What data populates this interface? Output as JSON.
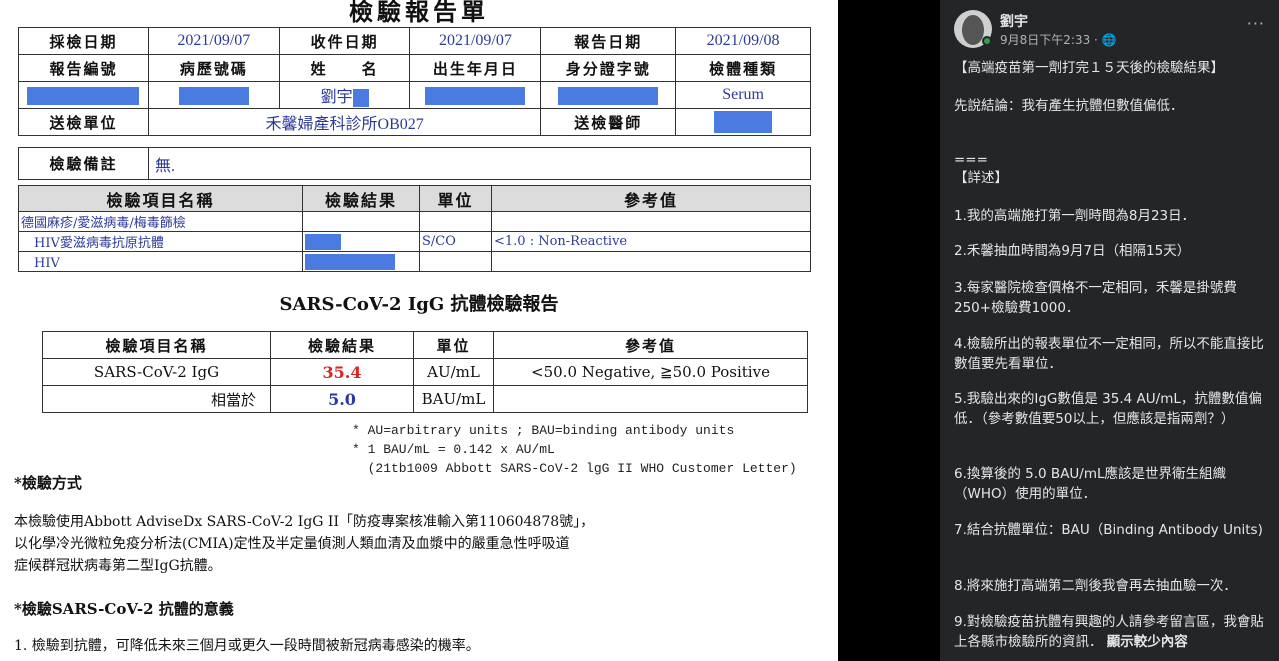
{
  "report": {
    "title": "檢驗報告單",
    "header": {
      "row1": [
        "採檢日期",
        "2021/09/07",
        "收件日期",
        "2021/09/07",
        "報告日期",
        "2021/09/08"
      ],
      "row2": [
        "報告編號",
        "病歷號碼",
        "姓　　名",
        "出生年月日",
        "身分證字號",
        "檢體種類"
      ],
      "name_value": "劉宇",
      "specimen": "Serum",
      "send_unit_label": "送檢單位",
      "send_unit_value": "禾馨婦產科診所OB027",
      "send_doctor_label": "送檢醫師"
    },
    "remark": {
      "label": "檢驗備註",
      "value": "無."
    },
    "items_table": {
      "headers": [
        "檢驗項目名稱",
        "檢驗結果",
        "單位",
        "參考值"
      ],
      "rows": [
        {
          "name": "德國麻疹/愛滋病毒/梅毒篩檢",
          "unit": "",
          "ref": ""
        },
        {
          "name": "　HIV愛滋病毒抗原抗體",
          "unit": "S/CO",
          "ref": "<1.0 : Non-Reactive"
        },
        {
          "name": "　HIV",
          "unit": "",
          "ref": ""
        }
      ]
    },
    "igg_title": "SARS-CoV-2 IgG 抗體檢驗報告",
    "igg_table": {
      "headers": [
        "檢驗項目名稱",
        "檢驗結果",
        "單位",
        "參考值"
      ],
      "row1": {
        "name": "SARS-CoV-2 IgG",
        "result": "35.4",
        "unit": "AU/mL",
        "ref": "<50.0 Negative, ≧50.0 Positive"
      },
      "row2": {
        "name": "相當於",
        "result": "5.0",
        "unit": "BAU/mL",
        "ref": ""
      }
    },
    "notes": [
      "* AU=arbitrary units ; BAU=binding antibody units",
      "* 1 BAU/mL = 0.142 x AU/mL",
      "  (21tb1009 Abbott SARS-CoV-2 lgG II WHO Customer Letter)"
    ],
    "method_heading": "*檢驗方式",
    "method_text": [
      "本檢驗使用Abbott AdviseDx SARS-CoV-2 IgG II「防疫專案核准輸入第110604878號」，",
      "以化學冷光微粒免疫分析法(CMIA)定性及半定量偵測人類血清及血漿中的嚴重急性呼吸道",
      "症候群冠狀病毒第二型IgG抗體。"
    ],
    "meaning_heading": "*檢驗SARS-CoV-2 抗體的意義",
    "meaning_text": "1. 檢驗到抗體，可降低未來三個月或更久一段時間被新冠病毒感染的機率。"
  },
  "post": {
    "author": "劉宇",
    "timestamp": "9月8日下午2:33 · ",
    "privacy_icon": "globe-icon",
    "more_label": "···",
    "lines": [
      "【高端疫苗第一劑打完１５天後的檢驗結果】",
      "先說結論：我有產生抗體但數值偏低．",
      "===",
      "【詳述】",
      "1.我的高端施打第一劑時間為8月23日．",
      "2.禾馨抽血時間為9月7日（相隔15天）",
      "3.每家醫院檢查價格不一定相同，禾馨是掛號費250+檢驗費1000．",
      "4.檢驗所出的報表單位不一定相同，所以不能直接比數值要先看單位．",
      "5.我驗出來的IgG數值是 35.4 AU/mL，抗體數值偏低．（參考數值要50以上，但應該是指兩劑？）",
      "6.換算後的 5.0 BAU/mL應該是世界衛生組織（WHO）使用的單位．",
      "7.結合抗體單位：BAU（Binding Antibody Units)",
      "8.將來施打高端第二劑後我會再去抽血驗一次．",
      "9.對檢驗疫苗抗體有興趣的人請參考留言區，我會貼上各縣市檢驗所的資訊．"
    ],
    "see_more": "顯示較少內容"
  },
  "colors": {
    "post_bg": "#242526",
    "redaction": "#4a7be0",
    "result_red": "#d22222",
    "value_blue": "#2b3a9a"
  }
}
